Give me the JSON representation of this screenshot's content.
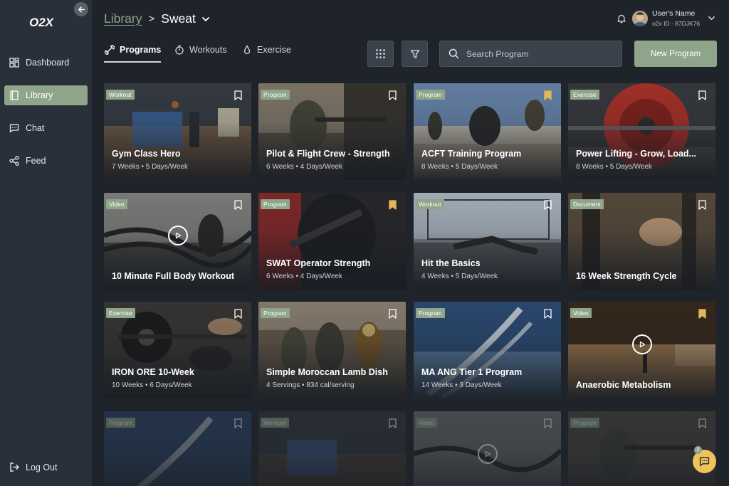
{
  "brand": {
    "logo_text": "O2X"
  },
  "sidebar": {
    "items": [
      {
        "label": "Dashboard",
        "icon": "grid-icon",
        "active": false
      },
      {
        "label": "Library",
        "icon": "book-icon",
        "active": true
      },
      {
        "label": "Chat",
        "icon": "chat-icon",
        "active": false
      },
      {
        "label": "Feed",
        "icon": "share-icon",
        "active": false
      }
    ],
    "logout_label": "Log Out"
  },
  "header": {
    "breadcrumb_parent": "Library",
    "breadcrumb_separator": ">",
    "breadcrumb_current": "Sweat",
    "user_name": "User's Name",
    "user_id": "o2x ID - 87DJK76"
  },
  "tabs": [
    {
      "label": "Programs",
      "icon": "dumbbell-icon",
      "active": true
    },
    {
      "label": "Workouts",
      "icon": "stopwatch-icon",
      "active": false
    },
    {
      "label": "Exercise",
      "icon": "drop-icon",
      "active": false
    }
  ],
  "search": {
    "placeholder": "Search Program"
  },
  "new_program_label": "New Program",
  "chat_badge_count": "2",
  "colors": {
    "accent": "#8ea58a",
    "bookmark_active": "#e0b75a",
    "background": "#1f242b",
    "sidebar": "#2a3039"
  },
  "cards": [
    {
      "badge": "Workout",
      "title": "Gym Class Hero",
      "meta": "7 Weeks • 5 Days/Week",
      "bookmarked": false
    },
    {
      "badge": "Program",
      "title": "Pilot & Flight Crew - Strength",
      "meta": "6 Weeks • 4 Days/Week",
      "bookmarked": false
    },
    {
      "badge": "Program",
      "title": "ACFT Training Program",
      "meta": "8 Weeks • 5 Days/Week",
      "bookmarked": true
    },
    {
      "badge": "Exercise",
      "title": "Power Lifting - Grow, Load...",
      "meta": "8 Weeks • 5 Days/Week",
      "bookmarked": false
    },
    {
      "badge": "Video",
      "title": "10 Minute Full Body Workout",
      "meta": "",
      "bookmarked": false
    },
    {
      "badge": "Program",
      "title": "SWAT Operator Strength",
      "meta": "6 Weeks • 4 Days/Week",
      "bookmarked": true
    },
    {
      "badge": "Workout",
      "title": "Hit the Basics",
      "meta": "4 Weeks • 5 Days/Week",
      "bookmarked": false
    },
    {
      "badge": "Document",
      "title": "16 Week Strength Cycle",
      "meta": "",
      "bookmarked": false
    },
    {
      "badge": "Exercise",
      "title": "IRON ORE 10-Week",
      "meta": "10 Weeks • 6 Days/Week",
      "bookmarked": false
    },
    {
      "badge": "Program",
      "title": "Simple Moroccan Lamb Dish",
      "meta": "4 Servings • 834 cal/serving",
      "bookmarked": false
    },
    {
      "badge": "Program",
      "title": "MA ANG Tier 1 Program",
      "meta": "14 Weeks • 3 Days/Week",
      "bookmarked": false
    },
    {
      "badge": "Video",
      "title": "Anaerobic Metabolism",
      "meta": "",
      "bookmarked": true
    },
    {
      "badge": "Program",
      "title": "",
      "meta": "",
      "bookmarked": false
    },
    {
      "badge": "Workout",
      "title": "",
      "meta": "",
      "bookmarked": false
    },
    {
      "badge": "Video",
      "title": "",
      "meta": "",
      "bookmarked": false
    },
    {
      "badge": "Program",
      "title": "",
      "meta": "",
      "bookmarked": false
    }
  ]
}
